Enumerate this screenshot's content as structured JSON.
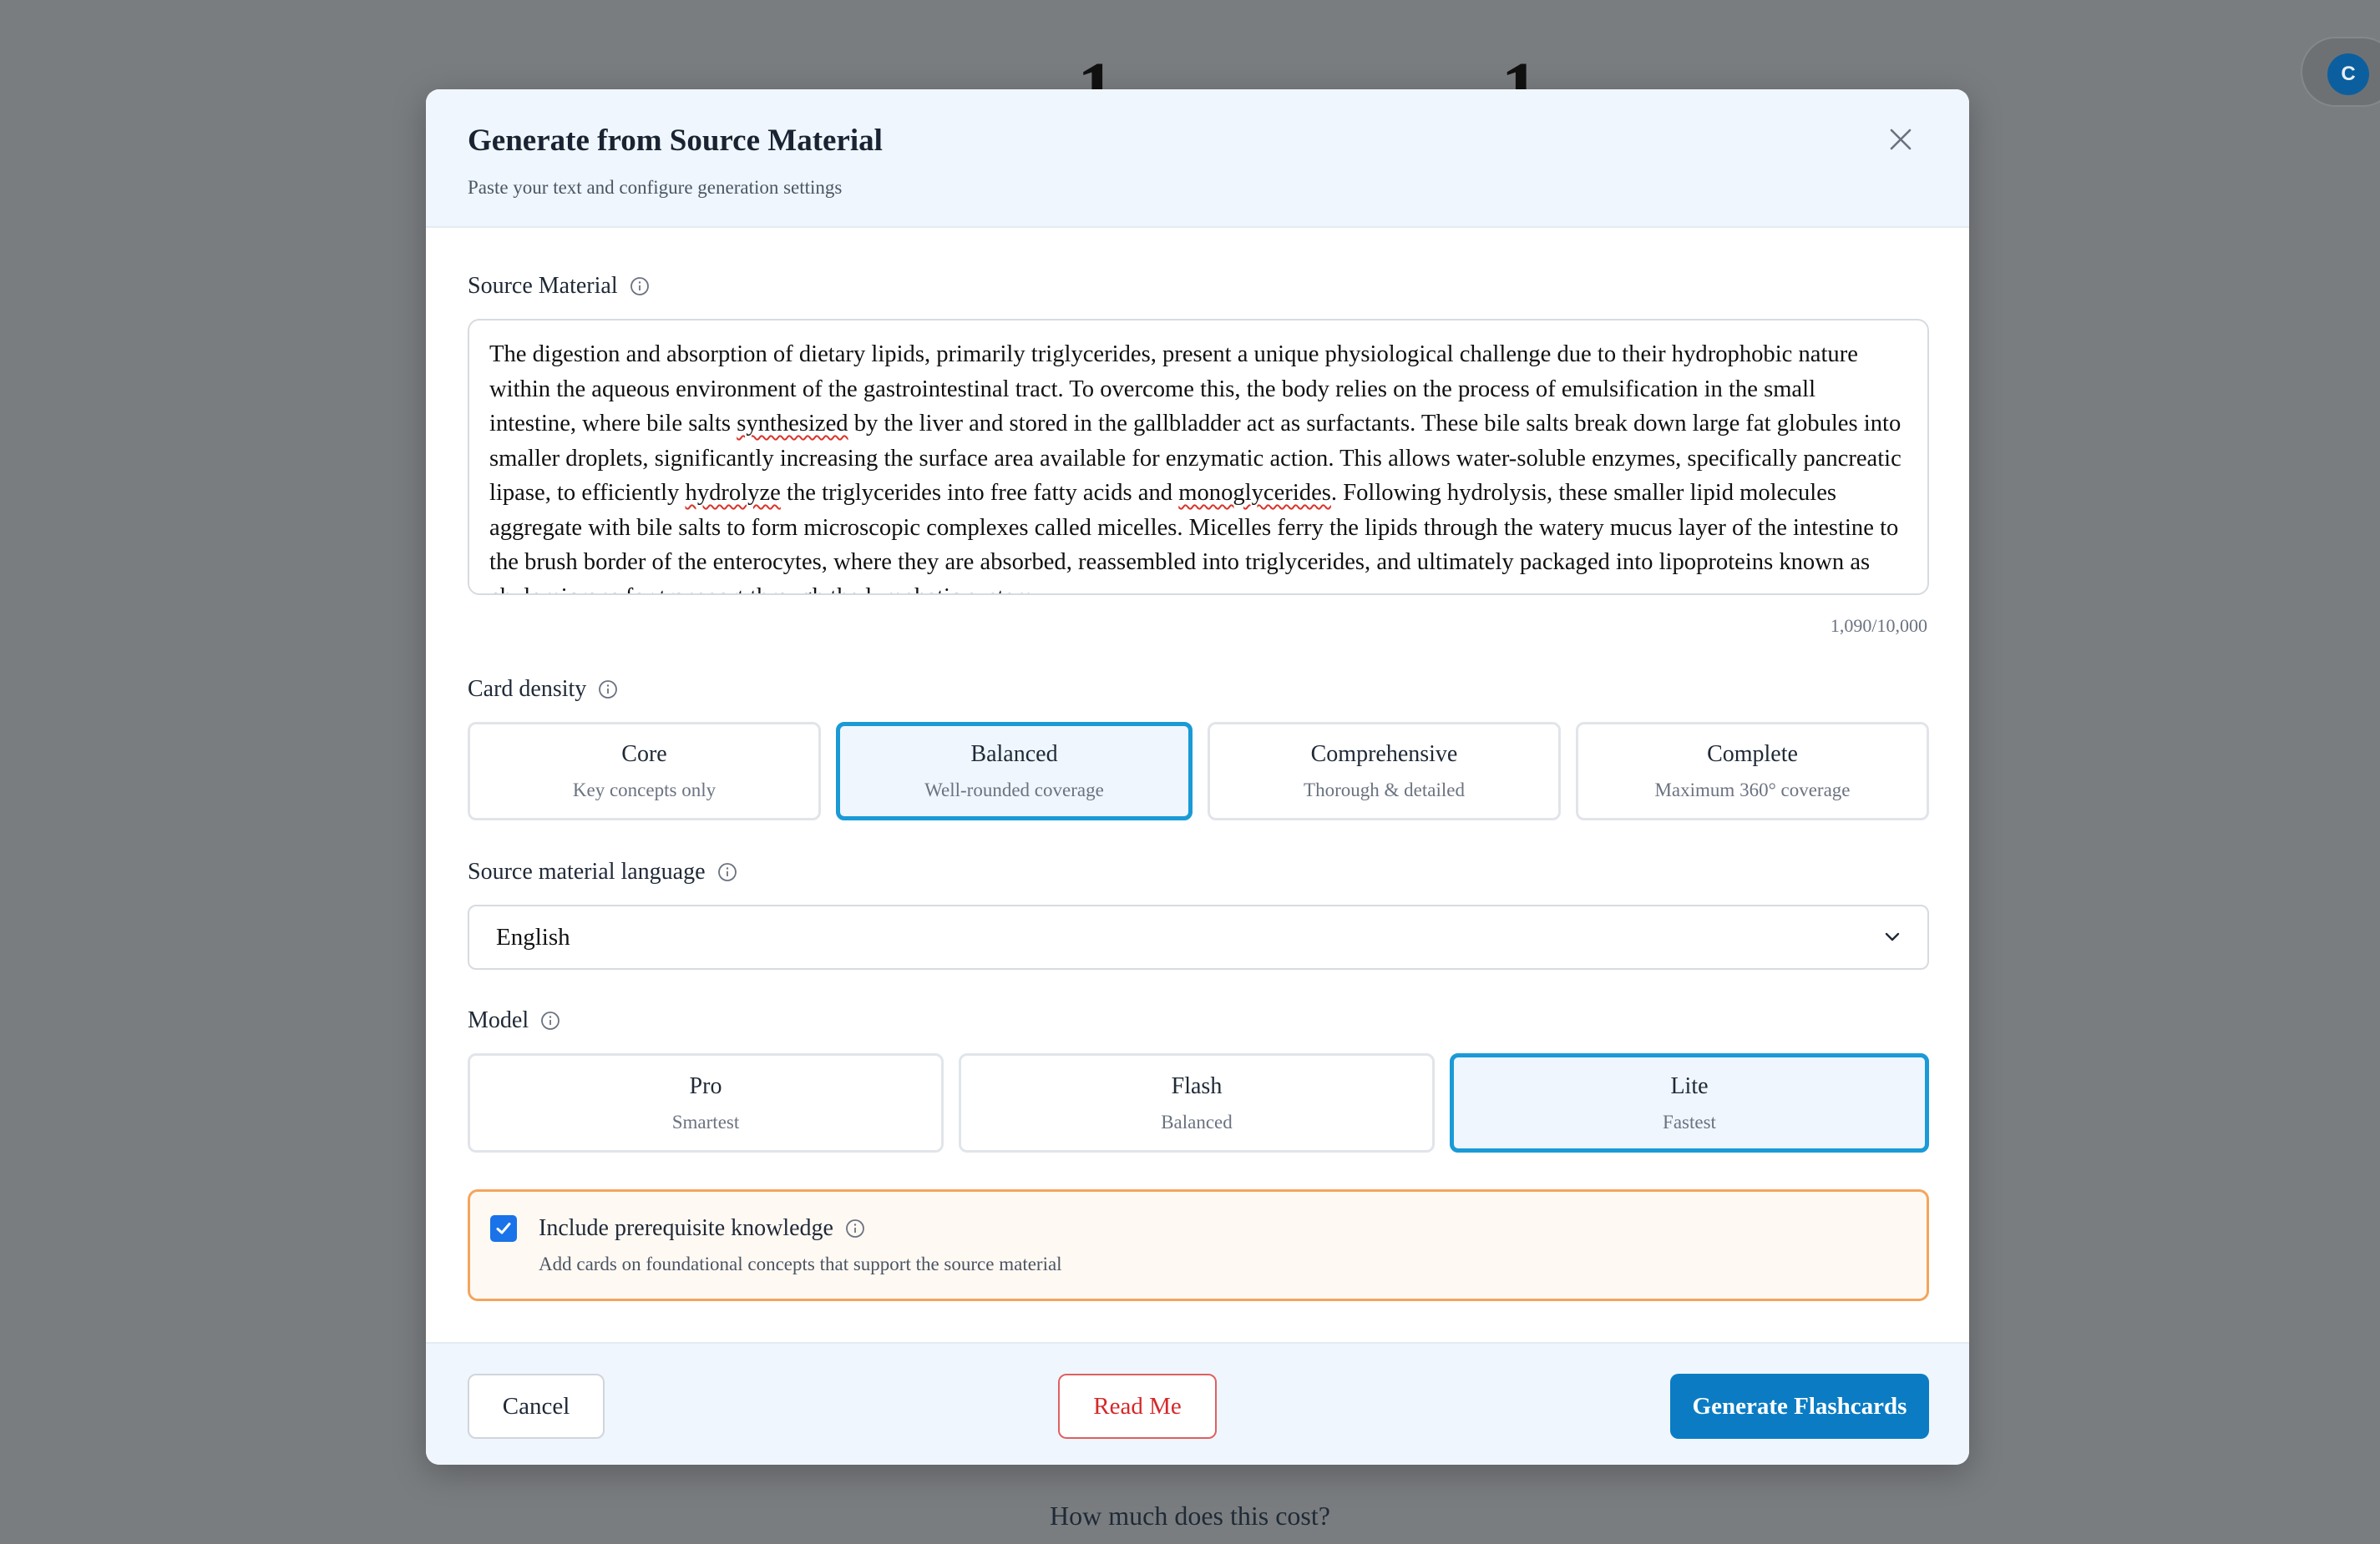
{
  "background": {
    "heading_fragment": "1 1",
    "avatar_initial": "C",
    "cost_question": "How much does this cost?"
  },
  "modal": {
    "title": "Generate from Source Material",
    "subtitle": "Paste your text and configure generation settings",
    "source": {
      "label": "Source Material",
      "text_parts": [
        "The digestion and absorption of dietary lipids, primarily triglycerides, present a unique physiological challenge due to their hydrophobic nature within the aqueous environment of the gastrointestinal tract. To overcome this, the body relies on the process of emulsification in the small intestine, where bile salts ",
        "synthesized",
        " by the liver and stored in the gallbladder act as surfactants. These bile salts break down large fat globules into smaller droplets, significantly increasing the surface area available for enzymatic action. This allows water-soluble enzymes, specifically pancreatic lipase, to efficiently ",
        "hydrolyze",
        " the triglycerides into free fatty acids and ",
        "monoglycerides",
        ". Following hydrolysis, these smaller lipid molecules aggregate with bile salts to form microscopic complexes called micelles. Micelles ferry the lipids through the watery mucus layer of the intestine to the brush border of the enterocytes, where they are absorbed, reassembled into triglycerides, and ultimately packaged into lipoproteins known as chylomicrons for transport through the lymphatic system."
      ],
      "char_count": "1,090/10,000"
    },
    "density": {
      "label": "Card density",
      "options": [
        {
          "title": "Core",
          "sub": "Key concepts only"
        },
        {
          "title": "Balanced",
          "sub": "Well-rounded coverage"
        },
        {
          "title": "Comprehensive",
          "sub": "Thorough & detailed"
        },
        {
          "title": "Complete",
          "sub": "Maximum 360° coverage"
        }
      ],
      "selected": "Balanced"
    },
    "language": {
      "label": "Source material language",
      "value": "English"
    },
    "model": {
      "label": "Model",
      "options": [
        {
          "title": "Pro",
          "sub": "Smartest"
        },
        {
          "title": "Flash",
          "sub": "Balanced"
        },
        {
          "title": "Lite",
          "sub": "Fastest"
        }
      ],
      "selected": "Lite"
    },
    "prerequisite": {
      "title": "Include prerequisite knowledge",
      "description": "Add cards on foundational concepts that support the source material",
      "checked": true
    },
    "footer": {
      "cancel": "Cancel",
      "read_me": "Read Me",
      "generate": "Generate Flashcards"
    }
  },
  "colors": {
    "accent": "#1a9ad6",
    "primary_button": "#0b7cc4",
    "warning_border": "#f4a55c",
    "danger": "#d62828"
  }
}
